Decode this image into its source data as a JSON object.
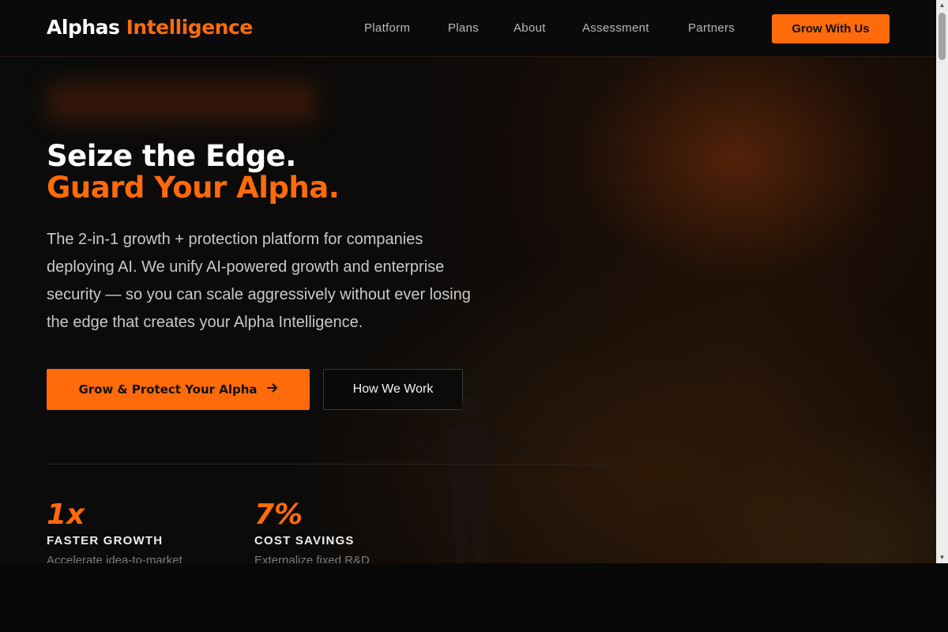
{
  "nav": {
    "logo_white": "Alphas",
    "logo_orange": "Intelligence",
    "links": [
      "Platform",
      "Plans",
      "About",
      "Assessment",
      "Partners"
    ],
    "cta": "Grow With Us"
  },
  "hero": {
    "headline_line1": "Seize the Edge.",
    "headline_line2": "Guard Your Alpha.",
    "lead": "The 2-in-1 growth + protection platform for companies deploying AI. We unify AI-powered growth and enterprise security — so you can scale aggressively without ever losing the edge that creates your Alpha Intelligence.",
    "primary_cta": "Grow & Protect Your Alpha",
    "secondary_cta": "How We Work"
  },
  "stats": [
    {
      "value": "1x",
      "label": "FASTER GROWTH",
      "description": "Accelerate idea-to-market"
    },
    {
      "value": "7%",
      "label": "COST SAVINGS",
      "description": "Externalize fixed R&D"
    }
  ],
  "colors": {
    "accent": "#ff6a0a",
    "background": "#0b0b0b"
  },
  "icons": {
    "primary_cta_icon": "arrow-right-icon"
  }
}
